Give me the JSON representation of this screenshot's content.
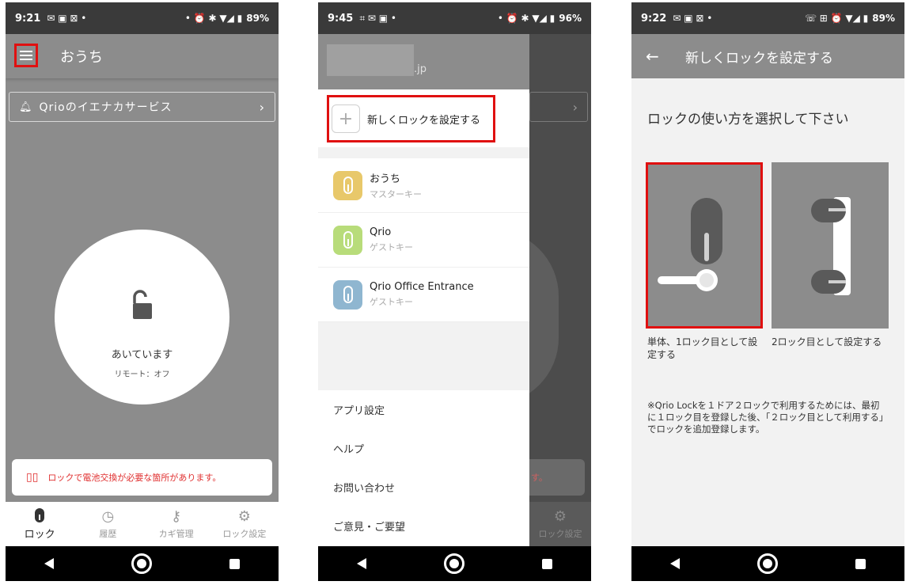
{
  "phone1": {
    "status": {
      "time": "9:21",
      "battery": "89%"
    },
    "title": "おうち",
    "service": "Qrioのイエナカサービス",
    "lock_status": "あいています",
    "remote": "リモート：オフ",
    "alert": "ロックで電池交換が必要な箇所があります。",
    "tabs": [
      "ロック",
      "履歴",
      "カギ管理",
      "ロック設定"
    ]
  },
  "phone2": {
    "status": {
      "time": "9:45",
      "battery": "96%"
    },
    "domain": ".jp",
    "new_lock": "新しくロックを設定する",
    "keys": [
      {
        "name": "おうち",
        "role": "マスターキー",
        "color": "#e8c86a"
      },
      {
        "name": "Qrio",
        "role": "ゲストキー",
        "color": "#b8dc7a"
      },
      {
        "name": "Qrio Office Entrance",
        "role": "ゲストキー",
        "color": "#8fb6d0"
      }
    ],
    "menu": [
      "アプリ設定",
      "ヘルプ",
      "お問い合わせ",
      "ご意見・ご要望"
    ],
    "behind_alert": "す。",
    "behind_tab": "ロック設定"
  },
  "phone3": {
    "status": {
      "time": "9:22",
      "battery": "89%"
    },
    "title": "新しくロックを設定する",
    "heading": "ロックの使い方を選択して下さい",
    "option1": "単体、1ロック目として設定する",
    "option2": "2ロック目として設定する",
    "note": "※Qrio Lockを１ドア２ロックで利用するためには、最初に１ロック目を登録した後、「２ロック目として利用する」でロックを追加登録します。"
  }
}
